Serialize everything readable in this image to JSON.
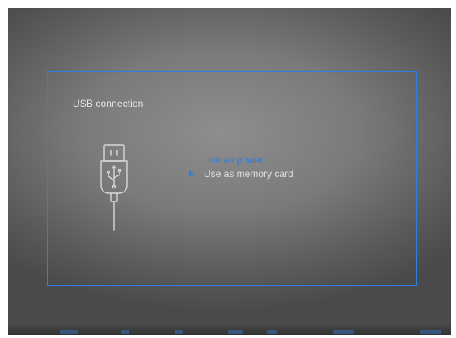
{
  "dialog": {
    "title": "USB connection",
    "icon": "usb-plug-icon",
    "options": [
      {
        "label": "Use as power",
        "highlighted": true
      },
      {
        "label": "Use as memory card",
        "selected": true
      }
    ]
  },
  "colors": {
    "accent": "#2f7fdc",
    "text": "#e0e0e0",
    "background": "#7a7a7a"
  }
}
